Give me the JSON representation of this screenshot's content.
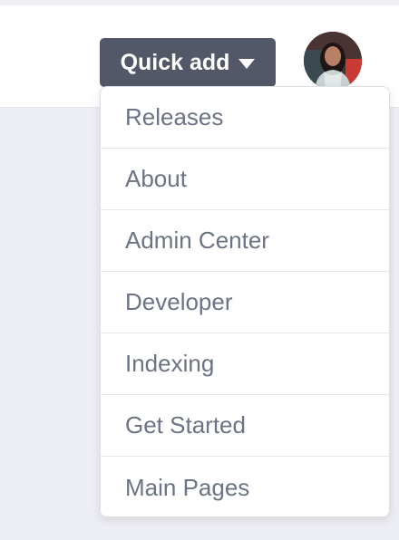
{
  "header": {
    "quick_add_label": "Quick add"
  },
  "menu": {
    "items": [
      {
        "label": "Releases"
      },
      {
        "label": "About"
      },
      {
        "label": "Admin Center"
      },
      {
        "label": "Developer"
      },
      {
        "label": "Indexing"
      },
      {
        "label": "Get Started"
      },
      {
        "label": "Main Pages"
      }
    ]
  },
  "colors": {
    "button_bg": "#525868",
    "menu_text": "#6c7384",
    "page_bg": "#edeef3"
  },
  "icons": {
    "caret": "caret-down-icon",
    "avatar": "user-avatar"
  }
}
